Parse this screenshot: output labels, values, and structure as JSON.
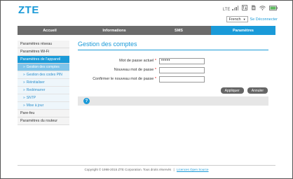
{
  "brand": {
    "logo": "ZTE"
  },
  "status": {
    "network": "LTE",
    "battery_icon": "battery-icon",
    "wifi_icon": "wifi-icon",
    "sms_icon": "message-icon"
  },
  "topbar": {
    "language": "French",
    "logout": "Se Déconnecter"
  },
  "nav": {
    "tabs": [
      {
        "label": "Accueil"
      },
      {
        "label": "Informations"
      },
      {
        "label": "SMS"
      },
      {
        "label": "Paramètres"
      }
    ]
  },
  "sidebar": {
    "items": [
      {
        "label": "Paramètres réseau"
      },
      {
        "label": "Paramètres Wi-Fi"
      },
      {
        "label": "Paramètres de l'appareil"
      },
      {
        "label": "Gestion des comptes"
      },
      {
        "label": "Gestion des codes PIN"
      },
      {
        "label": "Réinitialiser"
      },
      {
        "label": "Redémarrer"
      },
      {
        "label": "SNTP"
      },
      {
        "label": "Mise à jour"
      },
      {
        "label": "Pare-feu"
      },
      {
        "label": "Paramètres du routeur"
      }
    ]
  },
  "main": {
    "title": "Gestion des comptes",
    "fields": {
      "current": {
        "label": "Mot de passe actuel",
        "value": "•••••"
      },
      "new": {
        "label": "Nouveau mot de passe",
        "value": ""
      },
      "confirm": {
        "label": "Confirmer le nouveau mot de passe",
        "value": ""
      }
    },
    "required_mark": "*",
    "apply": "Appliquer",
    "cancel": "Annuler",
    "help": "?"
  },
  "footer": {
    "copyright": "Copyright © 1998-2015 ZTE Corporation. Tous droits réservés",
    "separator": "|",
    "license": "Licences Open Source"
  },
  "colors": {
    "accent": "#1a9ad8",
    "nav_bg": "#6b6b6b"
  }
}
